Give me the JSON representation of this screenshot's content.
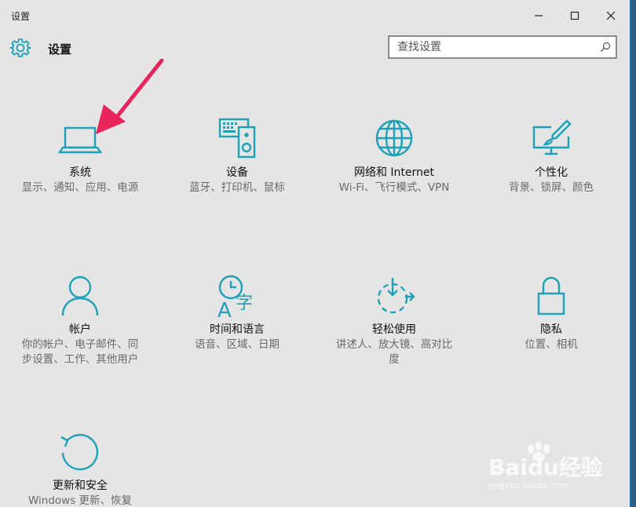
{
  "window": {
    "title": "设置"
  },
  "controls": {
    "minimize": "minimize-icon",
    "maximize": "maximize-icon",
    "close": "close-icon"
  },
  "header": {
    "title": "设置",
    "icon": "gear-icon"
  },
  "search": {
    "placeholder": "查找设置",
    "icon": "search-icon"
  },
  "accent": "#1ba1b8",
  "tiles": [
    {
      "label": "系统",
      "desc": "显示、通知、应用、电源",
      "icon": "laptop-icon"
    },
    {
      "label": "设备",
      "desc": "蓝牙、打印机、鼠标",
      "icon": "devices-icon"
    },
    {
      "label": "网络和 Internet",
      "desc": "Wi-Fi、飞行模式、VPN",
      "icon": "globe-icon"
    },
    {
      "label": "个性化",
      "desc": "背景、锁屏、颜色",
      "icon": "paintbrush-icon"
    },
    {
      "label": "帐户",
      "desc": "你的帐户、电子邮件、同步设置、工作、其他用户",
      "icon": "person-icon"
    },
    {
      "label": "时间和语言",
      "desc": "语音、区域、日期",
      "icon": "time-language-icon"
    },
    {
      "label": "轻松使用",
      "desc": "讲述人、放大镜、高对比度",
      "icon": "ease-of-access-icon"
    },
    {
      "label": "隐私",
      "desc": "位置、相机",
      "icon": "lock-icon"
    },
    {
      "label": "更新和安全",
      "desc": "Windows 更新、恢复",
      "icon": "update-icon"
    }
  ],
  "annotation": {
    "icon": "red-arrow-icon",
    "color": "#e8245a"
  },
  "watermark": {
    "text": "Baidu经验",
    "subtext": "jingyan.baidu.com"
  }
}
